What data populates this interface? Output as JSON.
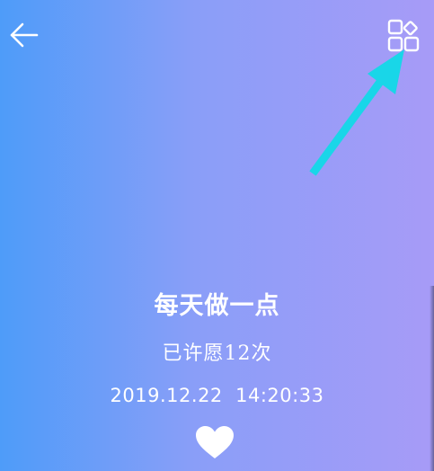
{
  "header": {
    "back_icon": "back-arrow-icon",
    "grid_icon": "grid-menu-icon"
  },
  "annotation": {
    "arrow_color": "#19d6e8"
  },
  "wish": {
    "title": "每天做一点",
    "count_text": "已许愿12次",
    "date": "2019.12.22",
    "time": "14:20:33",
    "datetime_text": "2019.12.22  14:20:33"
  },
  "actions": {
    "like_icon": "heart-icon"
  },
  "colors": {
    "gradient_start": "#4e9cf9",
    "gradient_end": "#a79bf7",
    "text": "#ffffff"
  }
}
